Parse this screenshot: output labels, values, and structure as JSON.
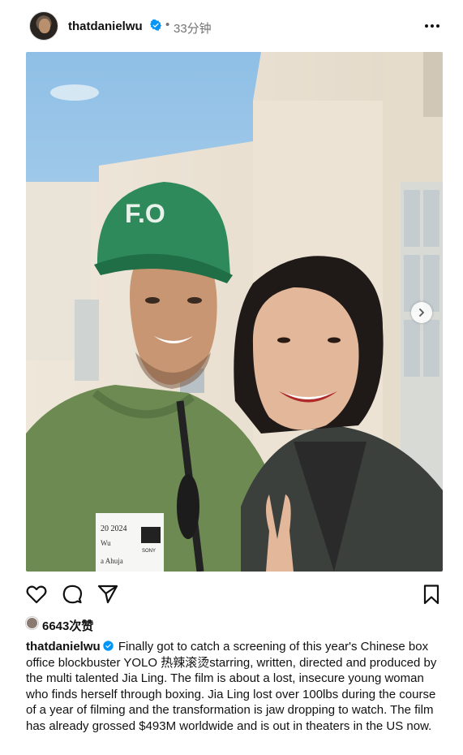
{
  "post": {
    "username": "thatdanielwu",
    "verified": true,
    "separator": "•",
    "time_ago": "33分钟",
    "more_label": "•••"
  },
  "media": {
    "cap_text": "F.O",
    "badge_line1": "20 2024",
    "badge_line2": "Wu",
    "badge_line3": "a Ahuja",
    "badge_logo": "SONY",
    "carousel_count": 3,
    "carousel_active": 0,
    "icon_next": "chevron-right-icon"
  },
  "actions": {
    "icons": [
      "heart-icon",
      "comment-icon",
      "share-icon",
      "bookmark-icon"
    ]
  },
  "likes": {
    "text": "6643次赞"
  },
  "caption": {
    "username": "thatdanielwu",
    "text": "Finally got to catch a screening of this year's Chinese box office blockbuster YOLO 热辣滚烫starring, written, directed and produced by the multi talented Jia Ling. The film is about a lost, insecure young woman who finds herself through boxing. Jia Ling lost over 100lbs during the course of a year of filming and the transformation is jaw dropping to watch. The film has already grossed $493M worldwide and is out in theaters in the US now."
  },
  "colors": {
    "verified": "#0095f6",
    "muted_text": "#737373",
    "text": "#111111"
  }
}
